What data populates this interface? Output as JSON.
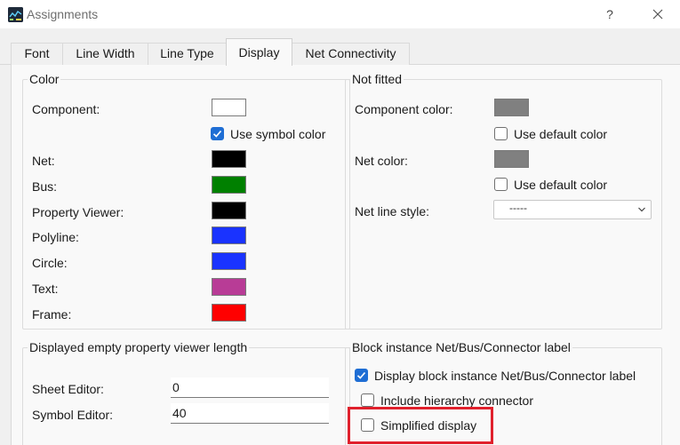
{
  "window": {
    "title": "Assignments",
    "help_label": "?"
  },
  "tabs": [
    {
      "label": "Font",
      "active": false
    },
    {
      "label": "Line Width",
      "active": false
    },
    {
      "label": "Line Type",
      "active": false
    },
    {
      "label": "Display",
      "active": true
    },
    {
      "label": "Net Connectivity",
      "active": false
    }
  ],
  "color_group": {
    "title": "Color",
    "component_label": "Component:",
    "component_color": "#ffffff",
    "use_symbol_color_label": "Use symbol color",
    "use_symbol_color_checked": true,
    "rows": [
      {
        "label": "Net:",
        "color": "#000000"
      },
      {
        "label": "Bus:",
        "color": "#008000"
      },
      {
        "label": "Property Viewer:",
        "color": "#000000"
      },
      {
        "label": "Polyline:",
        "color": "#1a33ff"
      },
      {
        "label": "Circle:",
        "color": "#1a33ff"
      },
      {
        "label": "Text:",
        "color": "#b83c96"
      },
      {
        "label": "Frame:",
        "color": "#ff0000"
      }
    ]
  },
  "not_fitted_group": {
    "title": "Not fitted",
    "component_color_label": "Component color:",
    "component_color": "#808080",
    "component_default_label": "Use default color",
    "component_default_checked": false,
    "net_color_label": "Net color:",
    "net_color": "#808080",
    "net_default_label": "Use default color",
    "net_default_checked": false,
    "net_line_style_label": "Net line style:",
    "net_line_style_value": "-----"
  },
  "empty_length_group": {
    "title": "Displayed empty property viewer length",
    "sheet_editor_label": "Sheet Editor:",
    "sheet_editor_value": "0",
    "symbol_editor_label": "Symbol Editor:",
    "symbol_editor_value": "40"
  },
  "block_instance_group": {
    "title": "Block instance Net/Bus/Connector label",
    "display_label": "Display block instance Net/Bus/Connector label",
    "display_checked": true,
    "hierarchy_label": "Include hierarchy connector",
    "hierarchy_checked": false,
    "simplified_label": "Simplified display",
    "simplified_checked": false
  },
  "colors": {
    "highlight": "#e0202c",
    "checkbox_accent": "#1f6ed4"
  }
}
